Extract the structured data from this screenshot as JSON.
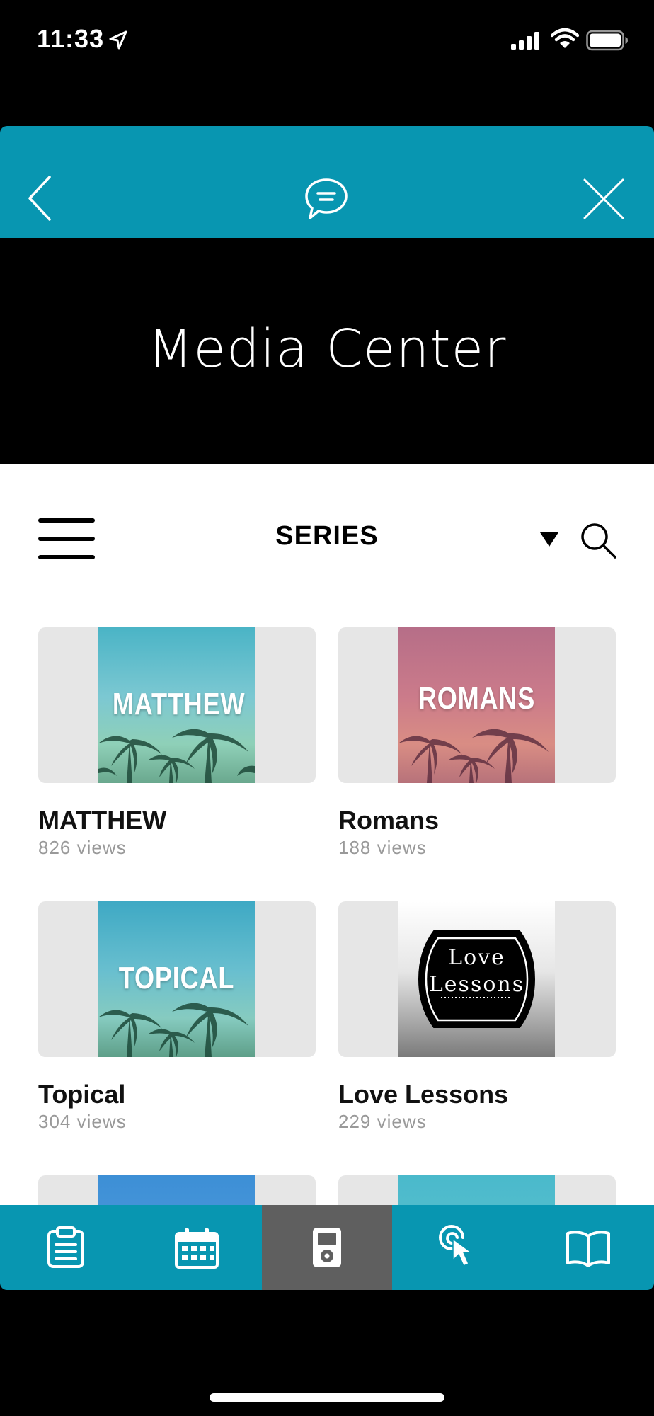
{
  "status_bar": {
    "time": "11:33",
    "icons": [
      "location-arrow-icon",
      "cellular-signal-icon",
      "wifi-icon",
      "battery-icon"
    ]
  },
  "top_nav": {
    "background_color": "#0896b1",
    "icons": [
      "back-chevron-icon",
      "chat-bubble-icon",
      "close-icon"
    ]
  },
  "hero": {
    "title": "Media Center"
  },
  "toolbar": {
    "section_title": "SERIES",
    "icons": [
      "hamburger-menu-icon",
      "dropdown-caret-icon",
      "search-icon"
    ]
  },
  "series": [
    {
      "title": "MATTHEW",
      "views": "826 views",
      "art_text": "MATTHEW"
    },
    {
      "title": "Romans",
      "views": "188 views",
      "art_text": "ROMANS"
    },
    {
      "title": "Topical",
      "views": "304 views",
      "art_text": "TOPICAL"
    },
    {
      "title": "Love Lessons",
      "views": "229 views",
      "art_text_line1": "Love",
      "art_text_line2": "Lessons"
    }
  ],
  "tab_bar": {
    "tabs": [
      {
        "icon": "clipboard-icon",
        "active": false
      },
      {
        "icon": "calendar-icon",
        "active": false
      },
      {
        "icon": "media-player-icon",
        "active": true
      },
      {
        "icon": "tap-pointer-icon",
        "active": false
      },
      {
        "icon": "open-book-icon",
        "active": false
      }
    ],
    "active_color": "#5f5f5f"
  }
}
